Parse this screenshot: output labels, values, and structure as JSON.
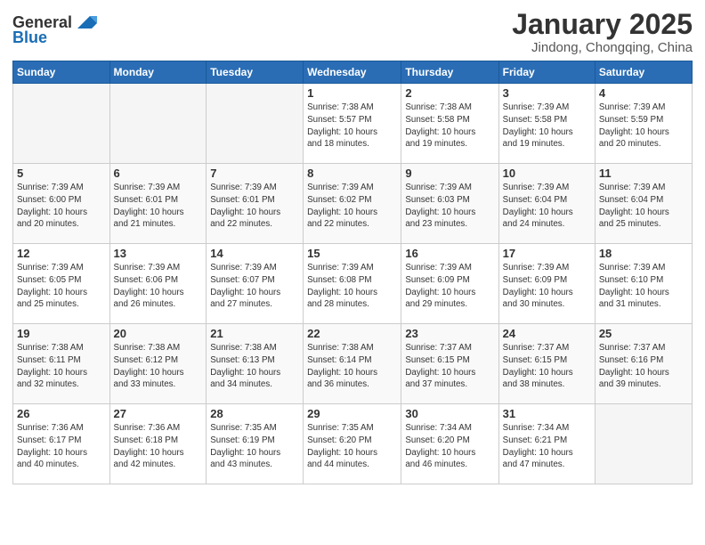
{
  "header": {
    "logo_general": "General",
    "logo_blue": "Blue",
    "month_title": "January 2025",
    "location": "Jindong, Chongqing, China"
  },
  "days_of_week": [
    "Sunday",
    "Monday",
    "Tuesday",
    "Wednesday",
    "Thursday",
    "Friday",
    "Saturday"
  ],
  "weeks": [
    [
      {
        "day": "",
        "info": "",
        "empty": true
      },
      {
        "day": "",
        "info": "",
        "empty": true
      },
      {
        "day": "",
        "info": "",
        "empty": true
      },
      {
        "day": "1",
        "info": "Sunrise: 7:38 AM\nSunset: 5:57 PM\nDaylight: 10 hours\nand 18 minutes.",
        "empty": false
      },
      {
        "day": "2",
        "info": "Sunrise: 7:38 AM\nSunset: 5:58 PM\nDaylight: 10 hours\nand 19 minutes.",
        "empty": false
      },
      {
        "day": "3",
        "info": "Sunrise: 7:39 AM\nSunset: 5:58 PM\nDaylight: 10 hours\nand 19 minutes.",
        "empty": false
      },
      {
        "day": "4",
        "info": "Sunrise: 7:39 AM\nSunset: 5:59 PM\nDaylight: 10 hours\nand 20 minutes.",
        "empty": false
      }
    ],
    [
      {
        "day": "5",
        "info": "Sunrise: 7:39 AM\nSunset: 6:00 PM\nDaylight: 10 hours\nand 20 minutes.",
        "empty": false
      },
      {
        "day": "6",
        "info": "Sunrise: 7:39 AM\nSunset: 6:01 PM\nDaylight: 10 hours\nand 21 minutes.",
        "empty": false
      },
      {
        "day": "7",
        "info": "Sunrise: 7:39 AM\nSunset: 6:01 PM\nDaylight: 10 hours\nand 22 minutes.",
        "empty": false
      },
      {
        "day": "8",
        "info": "Sunrise: 7:39 AM\nSunset: 6:02 PM\nDaylight: 10 hours\nand 22 minutes.",
        "empty": false
      },
      {
        "day": "9",
        "info": "Sunrise: 7:39 AM\nSunset: 6:03 PM\nDaylight: 10 hours\nand 23 minutes.",
        "empty": false
      },
      {
        "day": "10",
        "info": "Sunrise: 7:39 AM\nSunset: 6:04 PM\nDaylight: 10 hours\nand 24 minutes.",
        "empty": false
      },
      {
        "day": "11",
        "info": "Sunrise: 7:39 AM\nSunset: 6:04 PM\nDaylight: 10 hours\nand 25 minutes.",
        "empty": false
      }
    ],
    [
      {
        "day": "12",
        "info": "Sunrise: 7:39 AM\nSunset: 6:05 PM\nDaylight: 10 hours\nand 25 minutes.",
        "empty": false
      },
      {
        "day": "13",
        "info": "Sunrise: 7:39 AM\nSunset: 6:06 PM\nDaylight: 10 hours\nand 26 minutes.",
        "empty": false
      },
      {
        "day": "14",
        "info": "Sunrise: 7:39 AM\nSunset: 6:07 PM\nDaylight: 10 hours\nand 27 minutes.",
        "empty": false
      },
      {
        "day": "15",
        "info": "Sunrise: 7:39 AM\nSunset: 6:08 PM\nDaylight: 10 hours\nand 28 minutes.",
        "empty": false
      },
      {
        "day": "16",
        "info": "Sunrise: 7:39 AM\nSunset: 6:09 PM\nDaylight: 10 hours\nand 29 minutes.",
        "empty": false
      },
      {
        "day": "17",
        "info": "Sunrise: 7:39 AM\nSunset: 6:09 PM\nDaylight: 10 hours\nand 30 minutes.",
        "empty": false
      },
      {
        "day": "18",
        "info": "Sunrise: 7:39 AM\nSunset: 6:10 PM\nDaylight: 10 hours\nand 31 minutes.",
        "empty": false
      }
    ],
    [
      {
        "day": "19",
        "info": "Sunrise: 7:38 AM\nSunset: 6:11 PM\nDaylight: 10 hours\nand 32 minutes.",
        "empty": false
      },
      {
        "day": "20",
        "info": "Sunrise: 7:38 AM\nSunset: 6:12 PM\nDaylight: 10 hours\nand 33 minutes.",
        "empty": false
      },
      {
        "day": "21",
        "info": "Sunrise: 7:38 AM\nSunset: 6:13 PM\nDaylight: 10 hours\nand 34 minutes.",
        "empty": false
      },
      {
        "day": "22",
        "info": "Sunrise: 7:38 AM\nSunset: 6:14 PM\nDaylight: 10 hours\nand 36 minutes.",
        "empty": false
      },
      {
        "day": "23",
        "info": "Sunrise: 7:37 AM\nSunset: 6:15 PM\nDaylight: 10 hours\nand 37 minutes.",
        "empty": false
      },
      {
        "day": "24",
        "info": "Sunrise: 7:37 AM\nSunset: 6:15 PM\nDaylight: 10 hours\nand 38 minutes.",
        "empty": false
      },
      {
        "day": "25",
        "info": "Sunrise: 7:37 AM\nSunset: 6:16 PM\nDaylight: 10 hours\nand 39 minutes.",
        "empty": false
      }
    ],
    [
      {
        "day": "26",
        "info": "Sunrise: 7:36 AM\nSunset: 6:17 PM\nDaylight: 10 hours\nand 40 minutes.",
        "empty": false
      },
      {
        "day": "27",
        "info": "Sunrise: 7:36 AM\nSunset: 6:18 PM\nDaylight: 10 hours\nand 42 minutes.",
        "empty": false
      },
      {
        "day": "28",
        "info": "Sunrise: 7:35 AM\nSunset: 6:19 PM\nDaylight: 10 hours\nand 43 minutes.",
        "empty": false
      },
      {
        "day": "29",
        "info": "Sunrise: 7:35 AM\nSunset: 6:20 PM\nDaylight: 10 hours\nand 44 minutes.",
        "empty": false
      },
      {
        "day": "30",
        "info": "Sunrise: 7:34 AM\nSunset: 6:20 PM\nDaylight: 10 hours\nand 46 minutes.",
        "empty": false
      },
      {
        "day": "31",
        "info": "Sunrise: 7:34 AM\nSunset: 6:21 PM\nDaylight: 10 hours\nand 47 minutes.",
        "empty": false
      },
      {
        "day": "",
        "info": "",
        "empty": true
      }
    ]
  ]
}
